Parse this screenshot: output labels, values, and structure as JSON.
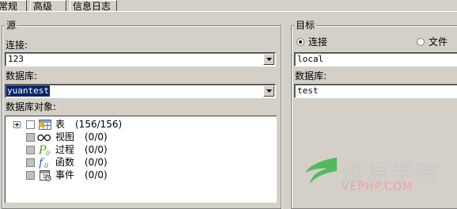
{
  "tabs": [
    {
      "label": "常规",
      "active": true
    },
    {
      "label": "高级",
      "active": false
    },
    {
      "label": "信息日志",
      "active": false
    }
  ],
  "source": {
    "legend": "源",
    "connection_label": "连接:",
    "connection_value": "123",
    "database_label": "数据库:",
    "database_value": "yuantest",
    "objects_label": "数据库对象:",
    "objects": [
      {
        "name": "表",
        "count": "(156/156)",
        "icon": "table-icon"
      },
      {
        "name": "视图",
        "count": "(0/0)",
        "icon": "view-glasses-icon"
      },
      {
        "name": "过程",
        "count": "(0/0)",
        "icon": "procedure-icon"
      },
      {
        "name": "函数",
        "count": "(0/0)",
        "icon": "function-icon"
      },
      {
        "name": "事件",
        "count": "(0/0)",
        "icon": "event-icon"
      }
    ]
  },
  "target": {
    "legend": "目标",
    "radio_connection": "连接",
    "radio_file": "文件",
    "selected": "连接",
    "connection_value": "local",
    "database_label": "数据库:",
    "database_value": "test"
  },
  "watermark": {
    "title": "维易学院",
    "subtitle": "VEPHP.COM",
    "accent_color": "#3cb54a"
  }
}
